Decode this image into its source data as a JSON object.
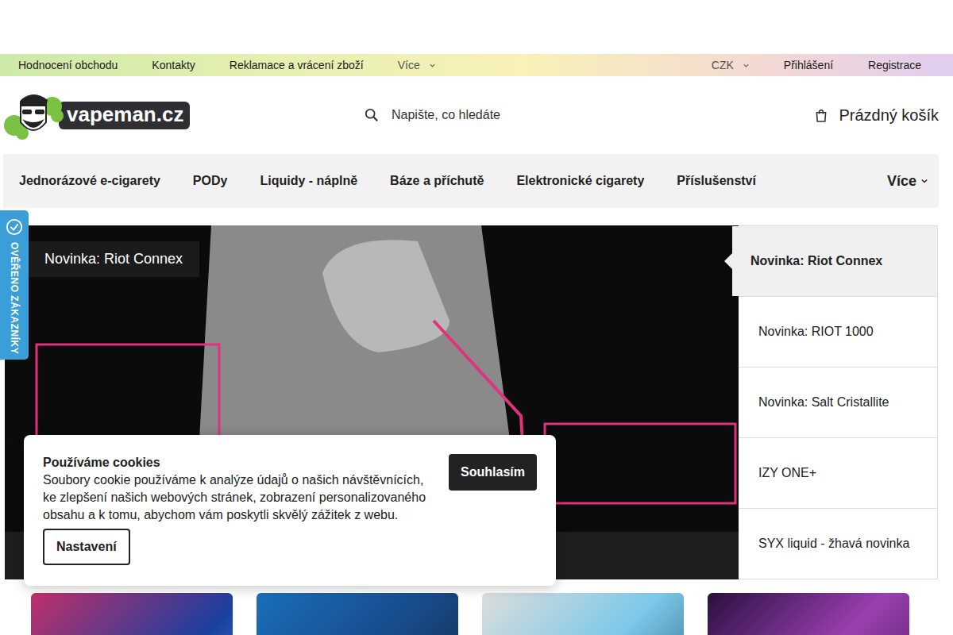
{
  "top_bar": {
    "links": [
      "Hodnocení obchodu",
      "Kontakty",
      "Reklamace a vrácení zboží"
    ],
    "more": "Více",
    "currency": "CZK",
    "login": "Přihlášení",
    "register": "Registrace"
  },
  "header": {
    "logo": "vapeman.cz",
    "search": {
      "placeholder": "Napište, co hledáte"
    },
    "cart": "Prázdný košík"
  },
  "nav": {
    "items": [
      "Jednorázové e-cigarety",
      "PODy",
      "Liquidy - náplně",
      "Báze a příchutě",
      "Elektronické cigarety",
      "Příslušenství"
    ],
    "more": "Více"
  },
  "badge": "OVĚŘENO ZÁKAZNÍKY",
  "carousel": {
    "caption": "Novinka: Riot Connex",
    "slides": [
      {
        "label": "Novinka: Riot Connex",
        "selected": true
      },
      {
        "label": "Novinka: RIOT 1000",
        "selected": false
      },
      {
        "label": "Novinka: Salt Cristallite",
        "selected": false
      },
      {
        "label": "IZY ONE+",
        "selected": false
      },
      {
        "label": "SYX liquid - žhavá novinka",
        "selected": false
      }
    ]
  },
  "promo_cards": [
    {
      "kind": "photo-smoke"
    },
    {
      "kind": "photo-fruit"
    },
    {
      "kind": "photo-man"
    },
    {
      "kind": "photo-woman"
    }
  ],
  "cookies": {
    "title": "Používáme cookies",
    "text": "Soubory cookie používáme k analýze údajů o našich návštěvnících, ke zlepšení našich webových stránek, zobrazení personalizovaného obsahu a k tomu, abychom vám poskytli skvělý zážitek z webu.",
    "accept": "Souhlasím",
    "settings": "Nastavení"
  }
}
